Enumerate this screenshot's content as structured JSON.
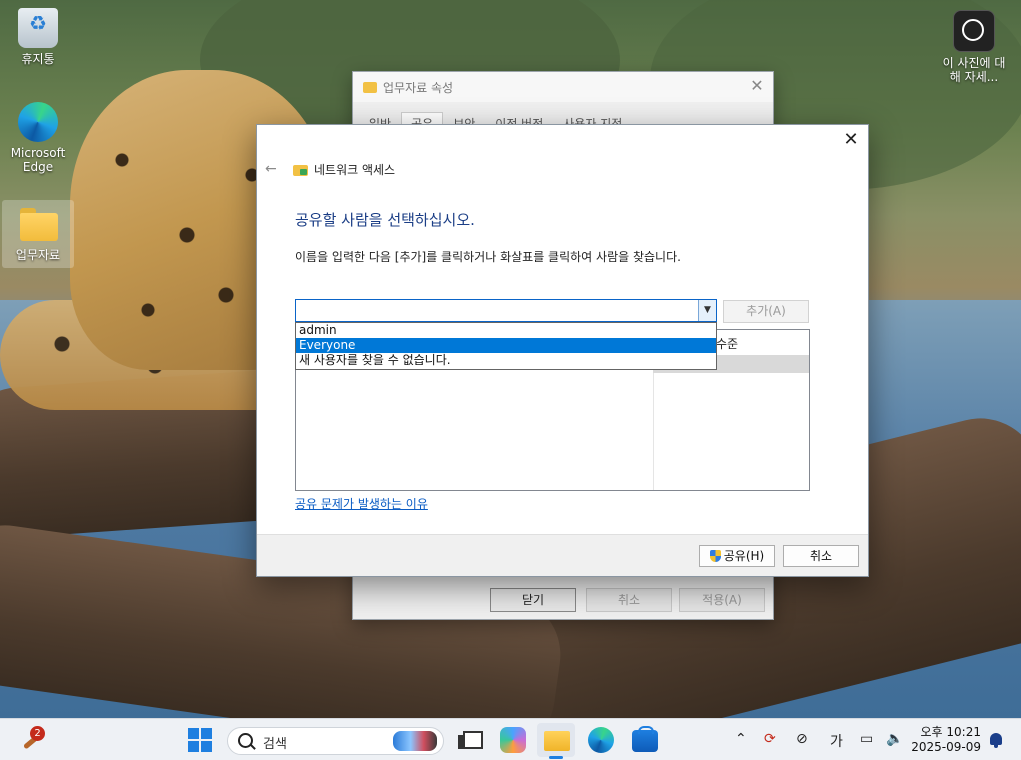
{
  "desktop": {
    "icons": [
      {
        "label": "휴지통"
      },
      {
        "label": "Microsoft Edge"
      },
      {
        "label": "업무자료"
      }
    ],
    "spotlight_label": "이 사진에 대해 자세..."
  },
  "properties_window": {
    "title": "업무자료 속성",
    "tabs": [
      "일반",
      "공유",
      "보안",
      "이전 버전",
      "사용자 지정"
    ],
    "active_tab": "공유",
    "buttons": {
      "close": "닫기",
      "cancel": "취소",
      "apply": "적용(A)"
    }
  },
  "network_dialog": {
    "header": "네트워크 액세스",
    "heading": "공유할 사람을 선택하십시오.",
    "description": "이름을 입력한 다음 [추가]를 클릭하거나 화살표를 클릭하여 사람을 찾습니다.",
    "combo_value": "",
    "add_button": "추가(A)",
    "dropdown_items": [
      "admin",
      "Everyone",
      "새 사용자를 찾을 수 없습니다."
    ],
    "dropdown_selected": "Everyone",
    "list_header_level": "수준",
    "help_link": "공유 문제가 발생하는 이유",
    "share_button": "공유(H)",
    "cancel_button": "취소"
  },
  "taskbar": {
    "notification_badge": "2",
    "search_placeholder": "검색",
    "ime_indicator": "가",
    "time": "오후 10:21",
    "date": "2025-09-09"
  },
  "colors": {
    "accent": "#0078d7",
    "heading": "#1b3e86",
    "link": "#0b5cc4"
  }
}
